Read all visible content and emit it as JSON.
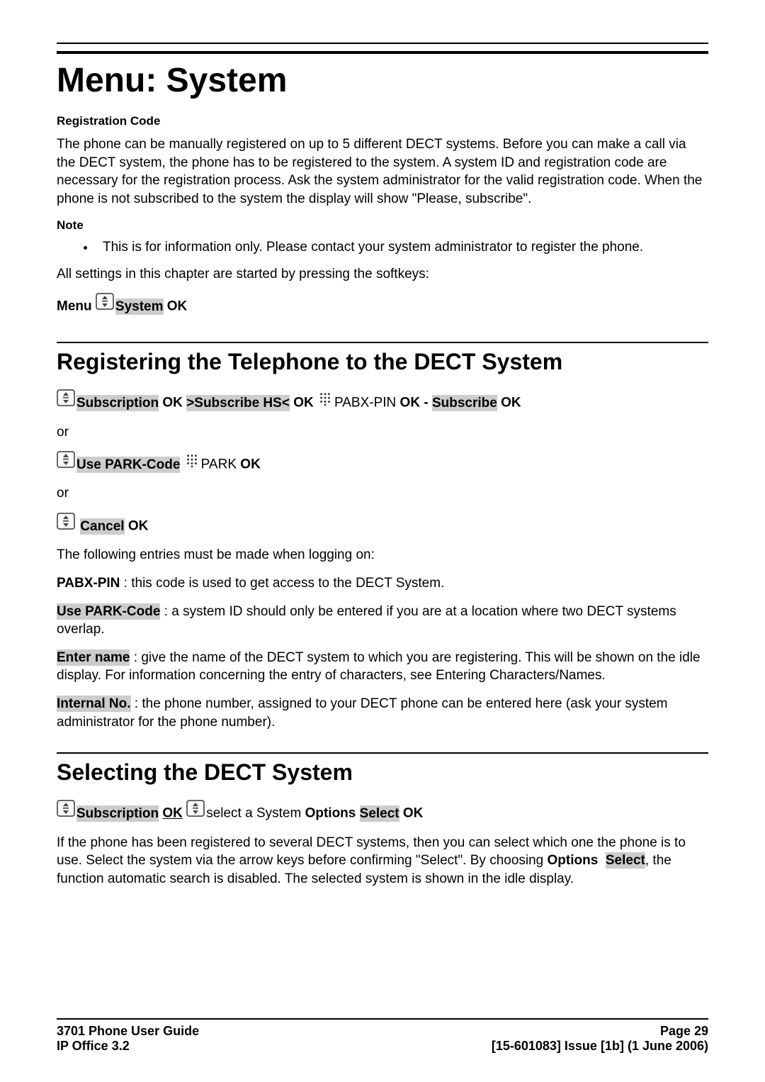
{
  "page_title": "Menu: System",
  "reg_code_heading": "Registration Code",
  "reg_code_para": "The phone can be manually registered on up to 5 different DECT systems. Before you can make a call via the DECT system, the phone has to be registered to the system. A system ID and registration code are necessary for the registration process. Ask the system administrator for the valid registration code. When the phone is not subscribed to the system the display will show \"Please, subscribe\".",
  "note_heading": "Note",
  "note_bullet": "This is for information only. Please contact your system administrator to register the phone.",
  "all_settings_para": "All settings in this chapter are started by pressing the softkeys:",
  "menu_system_line": {
    "menu": "Menu",
    "system": "System",
    "ok": "OK"
  },
  "registering_heading": "Registering the Telephone to the DECT System",
  "reg_line1": {
    "subscription": "Subscription",
    "ok1": "OK",
    "subscribe_hs": ">Subscribe HS<",
    "ok2": "OK",
    "pabx_pin": "PABX-PIN",
    "ok3": "OK",
    "dash": "-",
    "subscribe": "Subscribe",
    "ok4": "OK"
  },
  "or": "or",
  "reg_line2": {
    "use_park_code": "Use PARK-Code",
    "park": "PARK",
    "ok": "OK"
  },
  "reg_line3": {
    "cancel": "Cancel",
    "ok": "OK"
  },
  "following_entries": "The following entries must be made when logging on:",
  "pabx_pin_line": {
    "label": "PABX-PIN",
    "rest": " : this code is used to get access to the DECT System."
  },
  "use_park_line": {
    "label": "Use PARK-Code",
    "rest": " : a system ID should only be entered if you are at a location where two DECT systems overlap."
  },
  "enter_name_line": {
    "label": "Enter name",
    "rest": " : give the name of the DECT system to which you are registering. This will be shown on the idle display. For information concerning the entry of characters, see Entering Characters/Names."
  },
  "internal_no_line": {
    "label": "Internal No.",
    "rest": " : the phone number, assigned to your DECT phone can be entered here (ask your system administrator for the phone number)."
  },
  "selecting_heading": "Selecting the DECT System",
  "sel_line": {
    "subscription": "Subscription",
    "ok1": "OK",
    "select_system": "select a System",
    "options": "Options",
    "select": "Select",
    "ok2": "OK"
  },
  "selecting_para_1": "If the phone has been registered to several DECT systems, then you can select which one the phone is to use. Select the system via the arrow keys before confirming \"Select\". By choosing ",
  "selecting_para_options": "Options",
  "selecting_para_select": "Select",
  "selecting_para_2": ", the function automatic search is disabled. The selected system is shown in the idle display.",
  "footer": {
    "left1": "3701 Phone User Guide",
    "right1": "Page 29",
    "left2": "IP Office 3.2",
    "right2": "[15-601083] Issue [1b] (1 June 2006)"
  }
}
